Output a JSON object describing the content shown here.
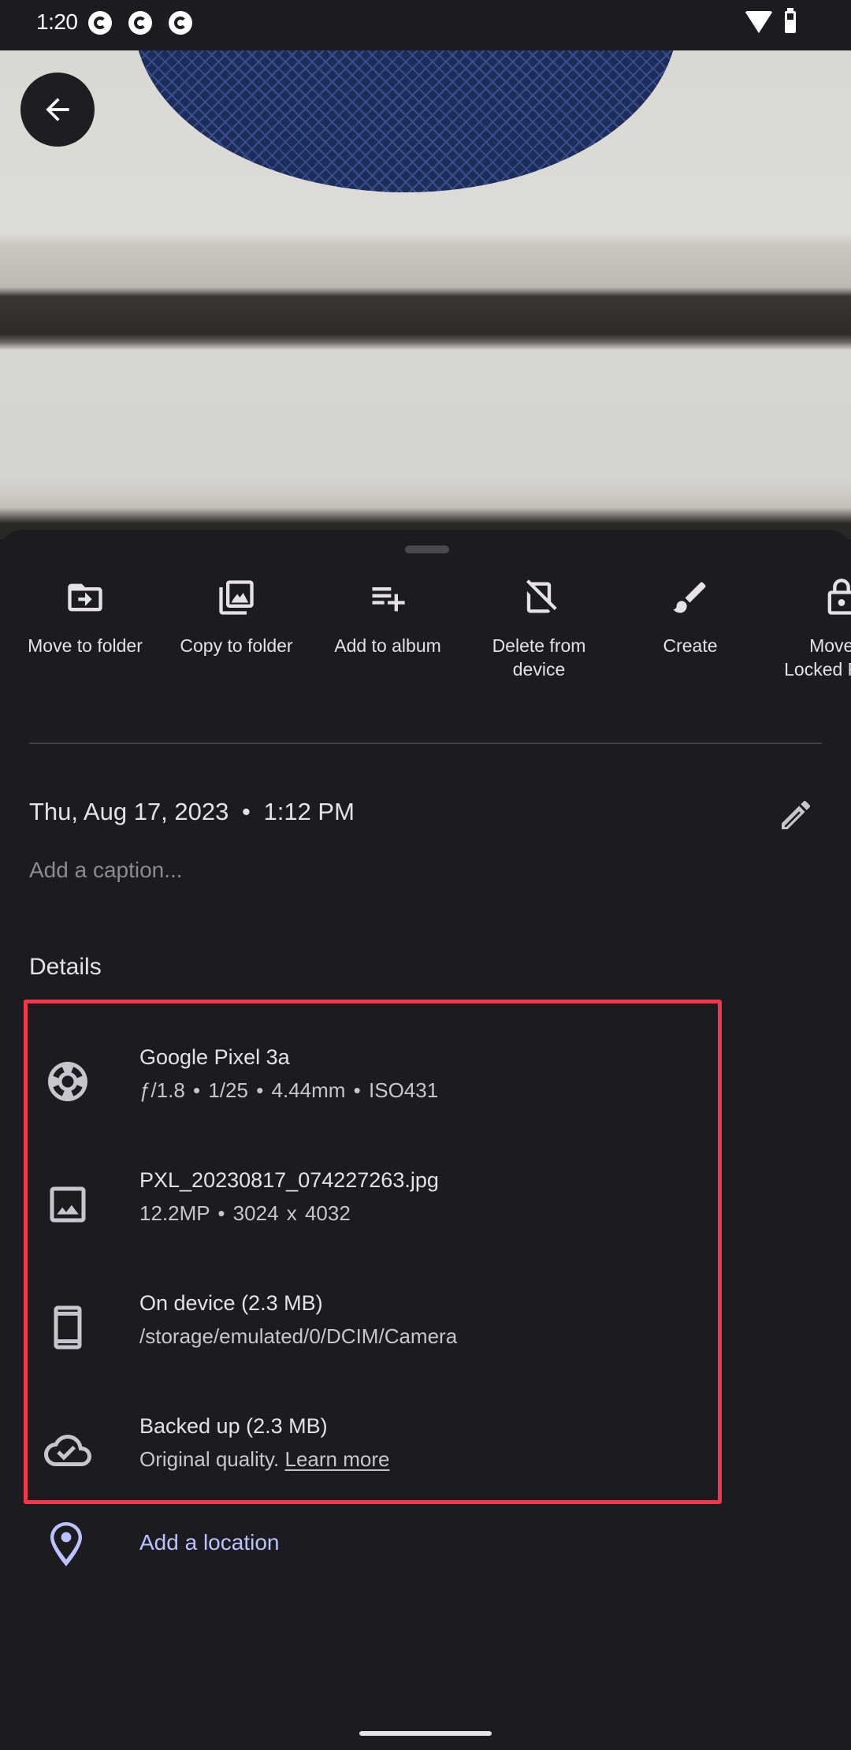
{
  "status_bar": {
    "time": "1:20",
    "notification_icons": [
      "c-notification-icon",
      "c-notification-icon",
      "c-notification-icon"
    ],
    "wifi": "wifi-icon",
    "battery": "battery-icon"
  },
  "photo": {
    "back_icon": "arrow-back-icon"
  },
  "actions": [
    {
      "label": "Move to folder",
      "icon": "move-to-folder-icon"
    },
    {
      "label": "Copy to folder",
      "icon": "copy-to-folder-icon"
    },
    {
      "label": "Add to album",
      "icon": "add-to-album-icon"
    },
    {
      "label": "Delete from device",
      "icon": "delete-from-device-icon"
    },
    {
      "label": "Create",
      "icon": "brush-icon"
    },
    {
      "label": "Move to Locked Folder",
      "icon": "lock-icon"
    }
  ],
  "info": {
    "date": "Thu, Aug 17, 2023",
    "separator": "•",
    "time": "1:12 PM",
    "caption_placeholder": "Add a caption...",
    "edit_icon": "edit-pencil-icon"
  },
  "details": {
    "title": "Details",
    "highlight_color": "#f2384a",
    "rows": [
      {
        "icon": "camera-aperture-icon",
        "title": "Google Pixel 3a",
        "subtitle": "ƒ/1.8  •  1/25  •  4.44mm  •  ISO431"
      },
      {
        "icon": "image-icon",
        "title": "PXL_20230817_074227263.jpg",
        "subtitle": "12.2MP  •  3024 x 4032"
      },
      {
        "icon": "phone-device-icon",
        "title": "On device (2.3 MB)",
        "subtitle": "/storage/emulated/0/DCIM/Camera"
      },
      {
        "icon": "cloud-done-icon",
        "title": "Backed up (2.3 MB)",
        "subtitle": "Original quality.",
        "link": "Learn more"
      }
    ]
  },
  "location": {
    "label": "Add a location",
    "icon": "location-pin-icon",
    "color": "#bac3ff"
  }
}
